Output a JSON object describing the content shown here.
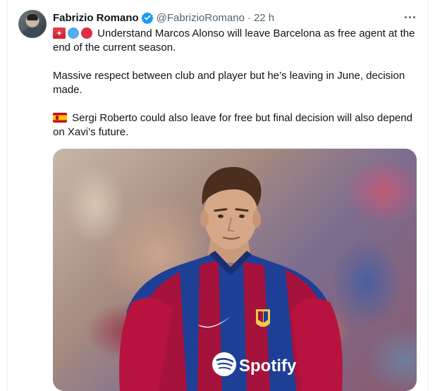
{
  "tweet": {
    "author_name": "Fabrizio Romano",
    "author_handle": "@FabrizioRomano",
    "separator": "·",
    "time": "22 h",
    "verified": true,
    "paragraphs": [
      "Understand Marcos Alonso will leave Barcelona as free agent at the end of the current season.",
      "Massive respect between club and player but he’s leaving in June, decision made.",
      "Sergi Roberto could also leave for free but final decision will also depend on Xavi’s future."
    ],
    "media": {
      "sponsor_text": "Spotify"
    }
  },
  "icons": {
    "verified": "verified-badge-icon",
    "more": "more-options-icon"
  },
  "colors": {
    "accent": "#1d9bf0",
    "secondary_text": "#536471",
    "barca_blue": "#1b3a8c",
    "barca_red": "#a5123b"
  }
}
